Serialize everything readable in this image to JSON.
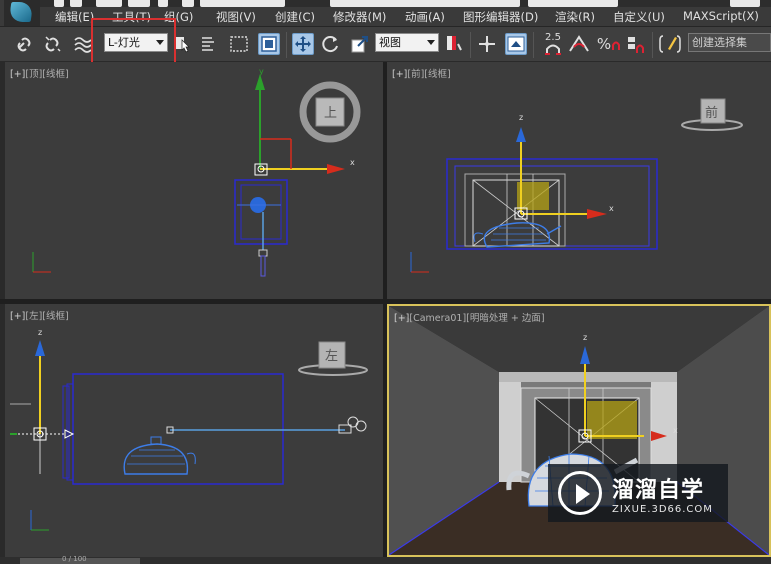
{
  "menu": {
    "items": [
      "编辑(E)",
      "工具(T)",
      "组(G)",
      "视图(V)",
      "创建(C)",
      "修改器(M)",
      "动画(A)",
      "图形编辑器(D)",
      "渲染(R)",
      "自定义(U)",
      "MAXScript(X)"
    ]
  },
  "toolbar": {
    "selection_filter": "L-灯光",
    "reference_coord": "视图",
    "angle_snap": "2.5",
    "percent_snap": "%",
    "named_selection_placeholder": "创建选择集",
    "highlight_color": "#d93030"
  },
  "viewports": {
    "top": {
      "plus": "[+]",
      "name": "[顶]",
      "mode": "[线框]",
      "cube_label": "上"
    },
    "front": {
      "plus": "[+]",
      "name": "[前]",
      "mode": "[线框]",
      "cube_label": "前",
      "axis_x": "x",
      "axis_z": "z"
    },
    "left": {
      "plus": "[+]",
      "name": "[左]",
      "mode": "[线框]",
      "cube_label": "左",
      "axis_z": "z"
    },
    "camera": {
      "plus": "[+]",
      "name": "[Camera01]",
      "mode": "[明暗处理 + 边面]",
      "axis_x": "x",
      "axis_z": "z"
    },
    "top_axis_x": "x",
    "top_axis_y": "y",
    "active_border_color": "#d8c25a"
  },
  "watermark": {
    "title": "溜溜自学",
    "url": "ZIXUE.3D66.COM"
  },
  "status": {
    "frame": "0 / 100"
  },
  "colors": {
    "axis_x": "#d62c1c",
    "axis_y": "#2ba12b",
    "axis_z": "#f0d020",
    "wireframe": "#2a2ad0"
  }
}
